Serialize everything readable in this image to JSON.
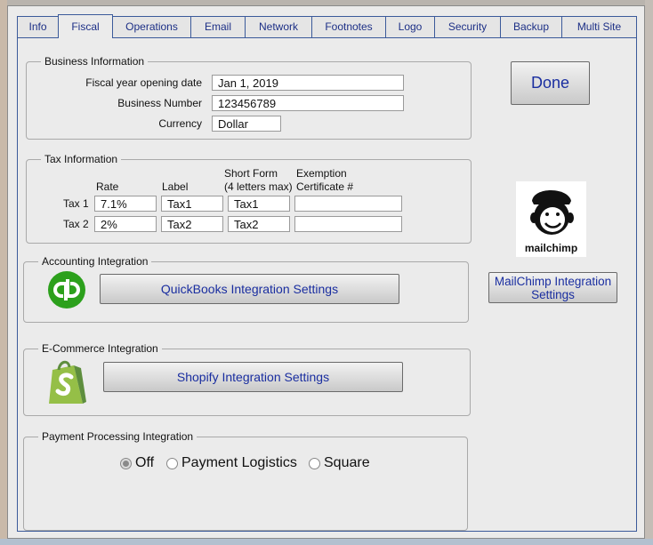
{
  "tabs": [
    {
      "label": "Info",
      "active": false
    },
    {
      "label": "Fiscal",
      "active": true
    },
    {
      "label": "Operations",
      "active": false
    },
    {
      "label": "Email",
      "active": false
    },
    {
      "label": "Network",
      "active": false
    },
    {
      "label": "Footnotes",
      "active": false
    },
    {
      "label": "Logo",
      "active": false
    },
    {
      "label": "Security",
      "active": false
    },
    {
      "label": "Backup",
      "active": false
    },
    {
      "label": "Multi Site",
      "active": false
    }
  ],
  "business": {
    "title": "Business Information",
    "fiscal_label": "Fiscal year opening date",
    "fiscal_value": "Jan 1, 2019",
    "number_label": "Business Number",
    "number_value": "123456789",
    "currency_label": "Currency",
    "currency_value": "Dollar"
  },
  "tax": {
    "title": "Tax Information",
    "col_rate": "Rate",
    "col_label": "Label",
    "col_short_1": "Short Form",
    "col_short_2": "(4 letters max)",
    "col_exempt_1": "Exemption",
    "col_exempt_2": "Certificate #",
    "rows": [
      {
        "name": "Tax 1",
        "rate": "7.1%",
        "label": "Tax1",
        "short": "Tax1",
        "exemption": ""
      },
      {
        "name": "Tax 2",
        "rate": "2%",
        "label": "Tax2",
        "short": "Tax2",
        "exemption": ""
      }
    ]
  },
  "accounting": {
    "title": "Accounting Integration",
    "button": "QuickBooks Integration Settings",
    "icon": "quickbooks-logo",
    "color": "#2ca01c"
  },
  "ecommerce": {
    "title": "E-Commerce Integration",
    "button": "Shopify Integration Settings",
    "icon": "shopify-logo",
    "color": "#95bf47"
  },
  "payment": {
    "title": "Payment Processing Integration",
    "options": [
      {
        "label": "Off",
        "checked": true
      },
      {
        "label": "Payment Logistics",
        "checked": false
      },
      {
        "label": "Square",
        "checked": false
      }
    ]
  },
  "done_button": "Done",
  "mailchimp": {
    "wordmark": "mailchimp",
    "button_line1": "MailChimp Integration",
    "button_line2": "Settings"
  },
  "colors": {
    "tab_text": "#1c2f86",
    "border_blue": "#3b5a9a",
    "dialog_bg": "#ebebeb"
  }
}
